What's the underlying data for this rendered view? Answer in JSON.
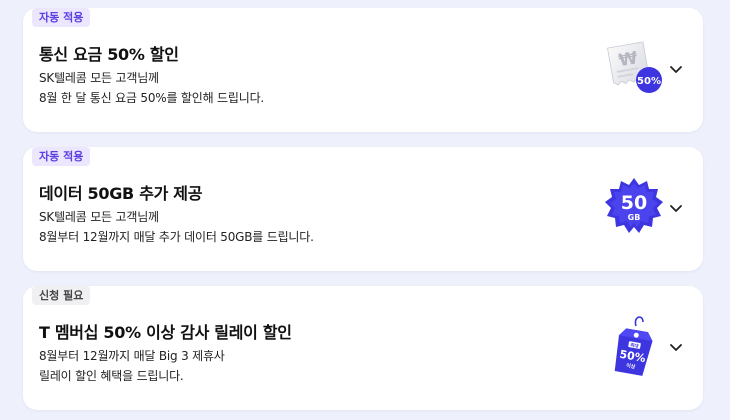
{
  "cards": [
    {
      "tag": "자동 적용",
      "title": "통신 요금 50% 할인",
      "line1": "SK텔레콤 모든 고객님께",
      "line2": "8월 한 달 통신 요금 50%를 할인해 드립니다.",
      "icon": "receipt-discount-icon",
      "badge_text": "50%",
      "symbol": "₩"
    },
    {
      "tag": "자동 적용",
      "title": "데이터 50GB 추가 제공",
      "line1": "SK텔레콤 모든 고객님께",
      "line2": "8월부터 12월까지 매달 추가 데이터 50GB를 드립니다.",
      "icon": "data-50gb-badge-icon",
      "badge_big": "50",
      "badge_small": "GB"
    },
    {
      "tag": "신청 필요",
      "title": "T 멤버십 50% 이상 감사 릴레이 할인",
      "line1": "8월부터 12월까지 매달 Big 3 제휴사",
      "line2": "릴레이 할인 혜택을 드립니다.",
      "icon": "price-tag-icon",
      "tag_top": "최대",
      "tag_mid": "50%",
      "tag_bottom": "이상"
    }
  ],
  "colors": {
    "accent": "#3d35e0",
    "tag_auto_bg": "#ece7ff",
    "tag_auto_fg": "#5b3fe0",
    "tag_need_bg": "#f0f0f2",
    "page_bg": "#eef1fb"
  }
}
